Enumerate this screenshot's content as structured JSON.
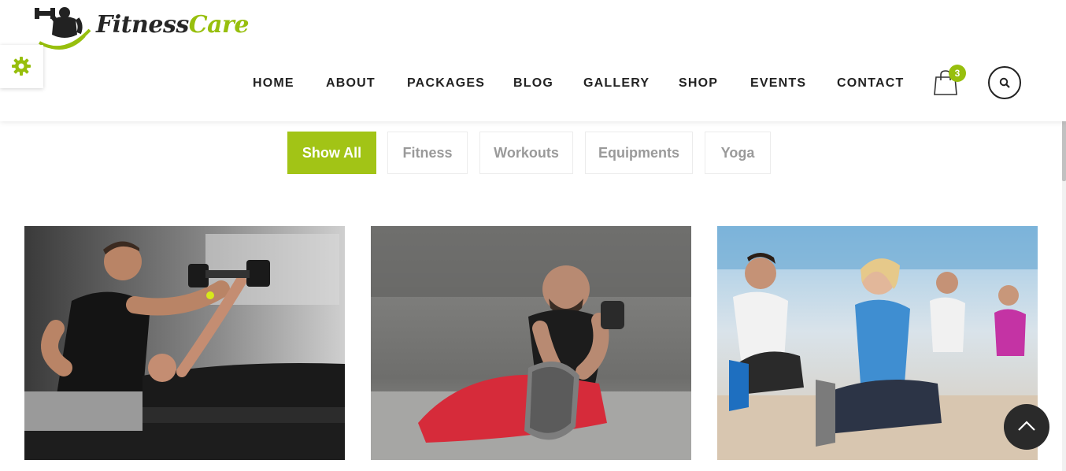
{
  "brand": {
    "part1": "Fitness",
    "part2": "Care"
  },
  "nav": {
    "items": [
      "HOME",
      "ABOUT",
      "PACKAGES",
      "BLOG",
      "GALLERY",
      "SHOP",
      "EVENTS",
      "CONTACT"
    ]
  },
  "cart": {
    "count": "3"
  },
  "filters": {
    "items": [
      "Show All",
      "Fitness",
      "Workouts",
      "Equipments",
      "Yoga"
    ],
    "active": "Show All"
  },
  "gallery": {
    "items": [
      {
        "icon": "trainer-assisted-dumbbell-press-photo"
      },
      {
        "icon": "man-hamstring-stretch-photo"
      },
      {
        "icon": "group-stretching-class-photo"
      }
    ]
  },
  "colors": {
    "accent": "#a2c416",
    "dark": "#222222"
  },
  "icons": {
    "settings": "gear-icon",
    "cart": "shopping-bag-icon",
    "search": "search-icon",
    "scroll_top": "chevron-up-icon"
  }
}
